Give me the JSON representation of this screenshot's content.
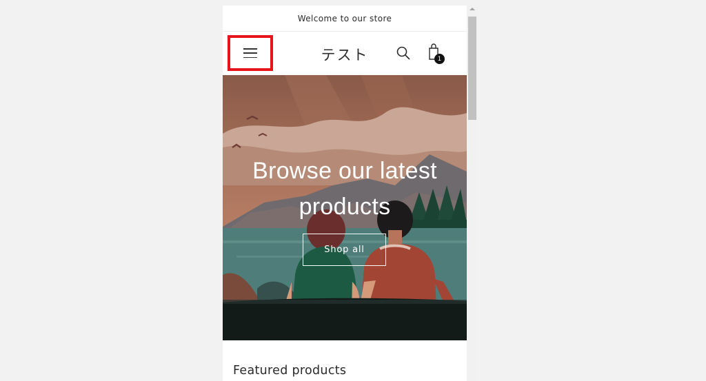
{
  "announcement": {
    "text": "Welcome to our store"
  },
  "header": {
    "logo": "テスト",
    "menu_icon": "hamburger-menu-icon",
    "search_icon": "search-icon",
    "cart_icon": "shopping-bag-icon",
    "cart_count": "1"
  },
  "hero": {
    "heading": "Browse our latest products",
    "button_label": "Shop all"
  },
  "featured": {
    "title": "Featured products"
  },
  "colors": {
    "highlight": "#e8141b",
    "background": "#f2f2f2",
    "text": "#2b2b2b"
  }
}
